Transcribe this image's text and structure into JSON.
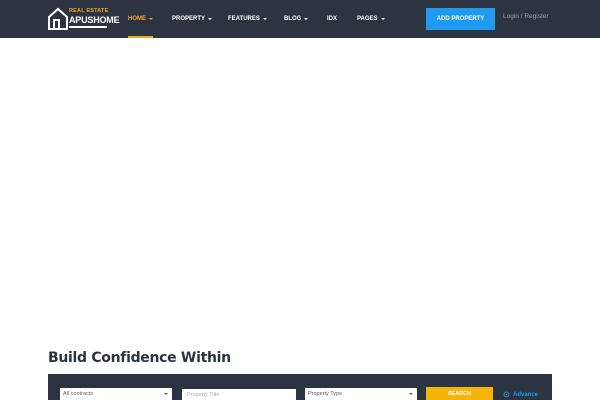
{
  "header": {
    "logo": {
      "tagline": "REAL ESTATE",
      "name": "APUSHOME"
    },
    "nav": [
      {
        "label": "HOME",
        "has_dropdown": true,
        "active": true
      },
      {
        "label": "PROPERTY",
        "has_dropdown": true,
        "active": false
      },
      {
        "label": "FEATURES",
        "has_dropdown": true,
        "active": false
      },
      {
        "label": "BLOG",
        "has_dropdown": true,
        "active": false
      },
      {
        "label": "IDX",
        "has_dropdown": false,
        "active": false
      },
      {
        "label": "PAGES",
        "has_dropdown": true,
        "active": false
      }
    ],
    "add_property_label": "ADD PROPERTY",
    "login_label": "Login / Register"
  },
  "hero": {
    "heading": "Build Confidence Within"
  },
  "search": {
    "contract_select": "All contracts",
    "title_placeholder": "Property Title",
    "type_select": "Property Type",
    "search_label": "SEARCH",
    "advance_label": "Advance"
  },
  "colors": {
    "header_bg": "#2b3440",
    "accent_yellow": "#f5a623",
    "button_blue": "#1e9bf0",
    "search_yellow": "#f5b40a"
  }
}
